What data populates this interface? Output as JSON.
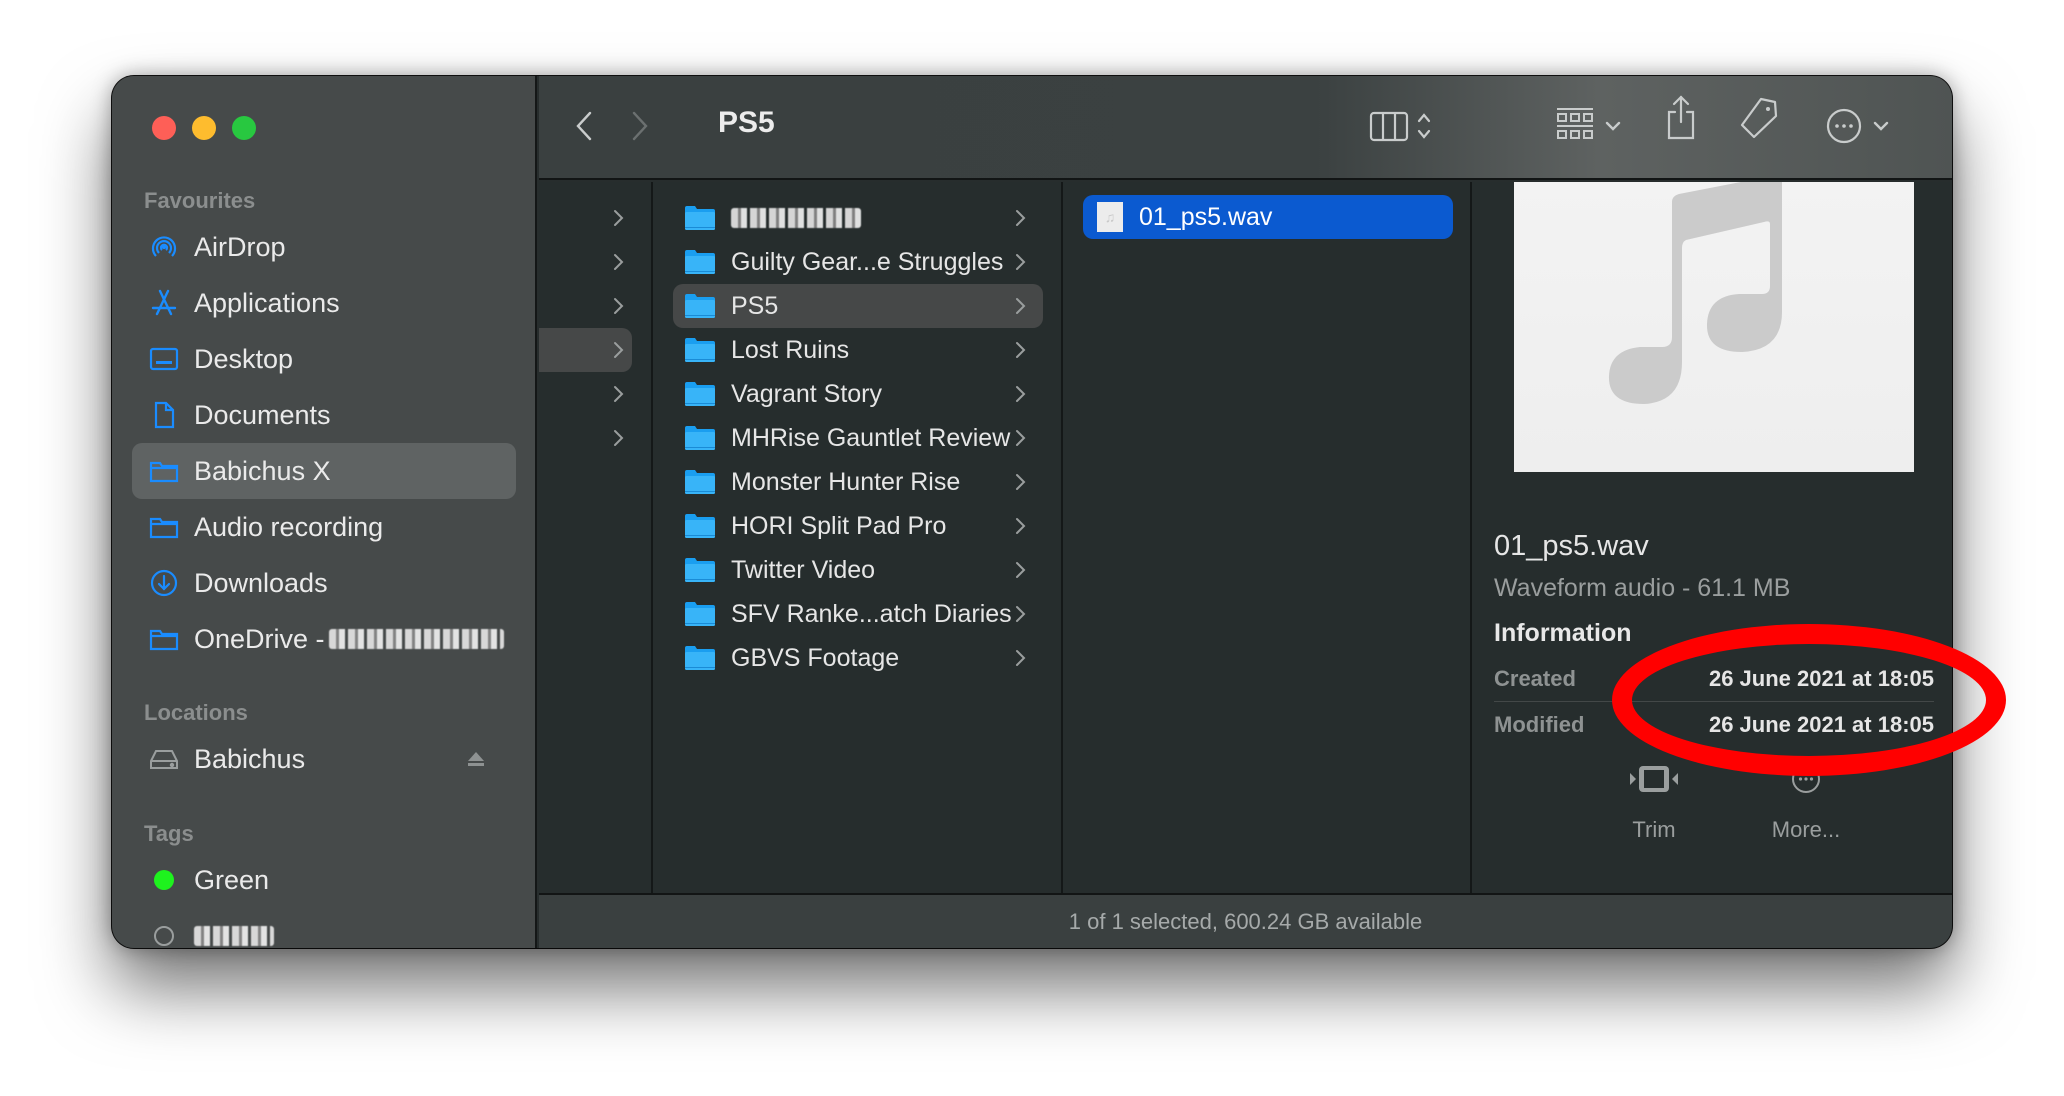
{
  "window": {
    "title": "PS5",
    "traffic_lights": {
      "close": "#fe5f57",
      "minimize": "#febc2e",
      "maximize": "#28c840"
    }
  },
  "toolbar": {
    "back_icon": "chevron-left-icon",
    "forward_icon": "chevron-right-icon",
    "title": "PS5",
    "view_icon": "column-view-icon",
    "group_icon": "group-grid-icon",
    "share_icon": "share-icon",
    "tag_icon": "tag-icon",
    "action_icon": "ellipsis-circle-icon",
    "search_icon": "search-icon"
  },
  "sidebar": {
    "sections": {
      "favourites": "Favourites",
      "locations": "Locations",
      "tags": "Tags"
    },
    "favourites": [
      {
        "label": "AirDrop",
        "icon": "airdrop-icon"
      },
      {
        "label": "Applications",
        "icon": "applications-icon"
      },
      {
        "label": "Desktop",
        "icon": "desktop-icon"
      },
      {
        "label": "Documents",
        "icon": "document-icon"
      },
      {
        "label": "Babichus X",
        "icon": "folder-icon",
        "selected": true
      },
      {
        "label": "Audio recording",
        "icon": "folder-icon"
      },
      {
        "label": "Downloads",
        "icon": "download-icon"
      },
      {
        "label": "OneDrive - ",
        "icon": "folder-icon",
        "redacted_suffix": true
      }
    ],
    "locations": [
      {
        "label": "Babichus",
        "icon": "drive-icon",
        "eject": true
      }
    ],
    "tags": [
      {
        "label": "Green",
        "color": "#1ef21e"
      },
      {
        "label": "",
        "color": "none",
        "redacted": true
      }
    ],
    "accent_color": "#1a8cff"
  },
  "columns": {
    "col1_rows": 6,
    "col1_selected_index": 3,
    "col2": [
      {
        "label": "",
        "redacted": true
      },
      {
        "label": "Guilty Gear...e Struggles"
      },
      {
        "label": "PS5",
        "selected": true
      },
      {
        "label": "Lost Ruins"
      },
      {
        "label": "Vagrant Story"
      },
      {
        "label": "MHRise Gauntlet Review"
      },
      {
        "label": "Monster Hunter Rise"
      },
      {
        "label": "HORI Split Pad Pro"
      },
      {
        "label": "Twitter Video"
      },
      {
        "label": "SFV Ranke...atch Diaries"
      },
      {
        "label": "GBVS Footage"
      }
    ],
    "col3": [
      {
        "label": "01_ps5.wav",
        "selected": true,
        "icon": "audio-file-icon"
      }
    ]
  },
  "preview": {
    "artwork_icon": "music-note-icon",
    "name": "01_ps5.wav",
    "kind": "Waveform audio - 61.1 MB",
    "info_header": "Information",
    "created_label": "Created",
    "created_value": "26 June 2021 at 18:05",
    "modified_label": "Modified",
    "modified_value": "26 June 2021 at 18:05",
    "actions": [
      {
        "label": "Trim",
        "icon": "trim-icon"
      },
      {
        "label": "More...",
        "icon": "more-icon"
      }
    ]
  },
  "statusbar": {
    "text": "1 of 1 selected, 600.24 GB available"
  },
  "annotation": {
    "type": "red-ellipse",
    "color": "#ff0000",
    "highlights": "created-modified-dates"
  }
}
